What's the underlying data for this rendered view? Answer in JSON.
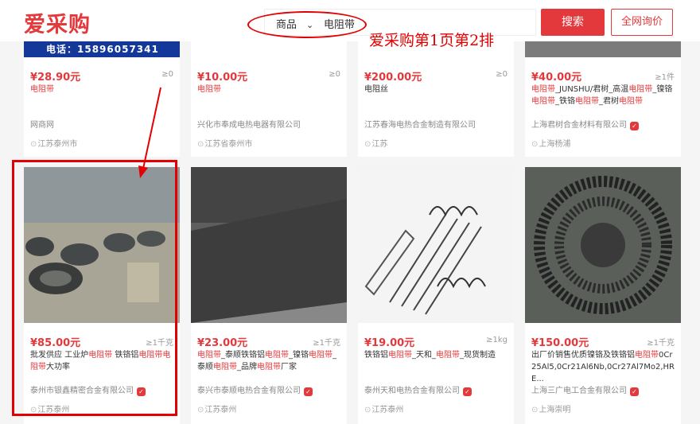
{
  "header": {
    "logo": "爱采购",
    "search_type": "商品",
    "search_value": "电阻带",
    "search_button": "搜索",
    "inquiry_button": "全网询价"
  },
  "annotation": {
    "note": "爱采购第1页第2排"
  },
  "row1": [
    {
      "phone": "电话：15896057341",
      "price": "¥28.90元",
      "moq": "≥0",
      "title_parts": [
        {
          "t": "电阻带",
          "hl": true
        }
      ],
      "company": "网商网",
      "badge": false,
      "location": "江苏泰州市"
    },
    {
      "price": "¥10.00元",
      "moq": "≥0",
      "title_parts": [
        {
          "t": "电阻带",
          "hl": true
        }
      ],
      "company": "兴化市奉成电热电器有限公司",
      "badge": false,
      "location": "江苏省泰州市"
    },
    {
      "price": "¥200.00元",
      "moq": "≥0",
      "title_parts": [
        {
          "t": "电阻丝",
          "hl": false
        }
      ],
      "company": "江苏春海电热合金制造有限公司",
      "badge": false,
      "location": "江苏"
    },
    {
      "price": "¥40.00元",
      "moq": "≥1件",
      "title_parts": [
        {
          "t": "电阻带",
          "hl": true
        },
        {
          "t": "_JUNSHU/君树_高温",
          "hl": false
        },
        {
          "t": "电阻带",
          "hl": true
        },
        {
          "t": "_镍铬",
          "hl": false
        },
        {
          "t": "电阻带",
          "hl": true
        },
        {
          "t": "_铁铬",
          "hl": false
        },
        {
          "t": "电阻带",
          "hl": true
        },
        {
          "t": "_君树",
          "hl": false
        },
        {
          "t": "电阻带",
          "hl": true
        }
      ],
      "company": "上海君树合金材料有限公司",
      "badge": true,
      "location": "上海杨浦"
    }
  ],
  "row2": [
    {
      "price": "¥85.00元",
      "moq": "≥1千克",
      "title_parts": [
        {
          "t": "批发供应 工业炉",
          "hl": false
        },
        {
          "t": "电阻带",
          "hl": true
        },
        {
          "t": " 铁铬铝",
          "hl": false
        },
        {
          "t": "电阻带",
          "hl": true
        },
        {
          "t": "电阻带",
          "hl": true
        },
        {
          "t": "大功率",
          "hl": false
        }
      ],
      "company": "泰州市银鑫精密合金有限公司",
      "badge": true,
      "location": "江苏泰州"
    },
    {
      "price": "¥23.00元",
      "moq": "≥1千克",
      "title_parts": [
        {
          "t": "电阻带",
          "hl": true
        },
        {
          "t": "_泰顺铁铬铝",
          "hl": false
        },
        {
          "t": "电阻带",
          "hl": true
        },
        {
          "t": "_镍铬",
          "hl": false
        },
        {
          "t": "电阻带",
          "hl": true
        },
        {
          "t": "_泰顺",
          "hl": false
        },
        {
          "t": "电阻带",
          "hl": true
        },
        {
          "t": "_品牌",
          "hl": false
        },
        {
          "t": "电阻带",
          "hl": true
        },
        {
          "t": "厂家",
          "hl": false
        }
      ],
      "company": "泰兴市泰顺电热合金有限公司",
      "badge": true,
      "location": "江苏泰州"
    },
    {
      "price": "¥19.00元",
      "moq": "≥1kg",
      "title_parts": [
        {
          "t": "铁铬铝",
          "hl": false
        },
        {
          "t": "电阻带",
          "hl": true
        },
        {
          "t": "_天和_",
          "hl": false
        },
        {
          "t": "电阻带",
          "hl": true
        },
        {
          "t": "_现货制造",
          "hl": false
        }
      ],
      "company": "泰州天和电热合金有限公司",
      "badge": true,
      "location": "江苏泰州"
    },
    {
      "price": "¥150.00元",
      "moq": "≥1千克",
      "title_parts": [
        {
          "t": "出厂价销售优质镍铬及铁铬铝",
          "hl": false
        },
        {
          "t": "电阻带",
          "hl": true
        },
        {
          "t": "0Cr25Al5,0Cr21Al6Nb,0Cr27Al7Mo2,HRE...",
          "hl": false
        }
      ],
      "company": "上海三广电工合金有限公司",
      "badge": true,
      "location": "上海崇明"
    }
  ]
}
